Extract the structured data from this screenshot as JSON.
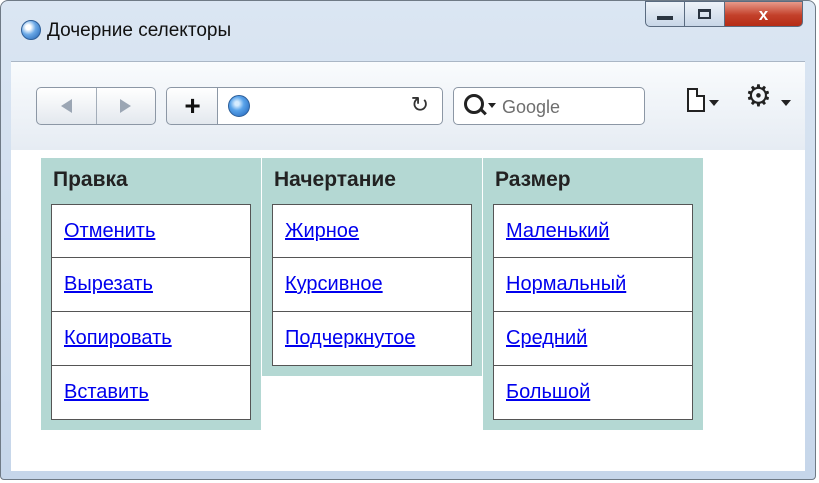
{
  "window": {
    "title": "Дочерние селекторы",
    "controls": [
      "minimize",
      "maximize",
      "close"
    ],
    "close_glyph": "x"
  },
  "toolbar": {
    "add_tab_label": "+",
    "reload_glyph": "↻",
    "search_placeholder": "Google",
    "icons": [
      "back-icon",
      "forward-icon",
      "globe-icon",
      "reload-icon",
      "search-icon",
      "page-icon",
      "gear-icon"
    ]
  },
  "menus": [
    {
      "title": "Правка",
      "items": [
        "Отменить",
        "Вырезать",
        "Копировать",
        "Вставить"
      ]
    },
    {
      "title": "Начертание",
      "items": [
        "Жирное",
        "Курсивное",
        "Подчеркнутое"
      ]
    },
    {
      "title": "Размер",
      "items": [
        "Маленький",
        "Нормальный",
        "Средний",
        "Большой"
      ]
    }
  ],
  "colors": {
    "menu_background": "#b4d8d3",
    "link": "#0000ee",
    "close_button": "#c3402a"
  }
}
